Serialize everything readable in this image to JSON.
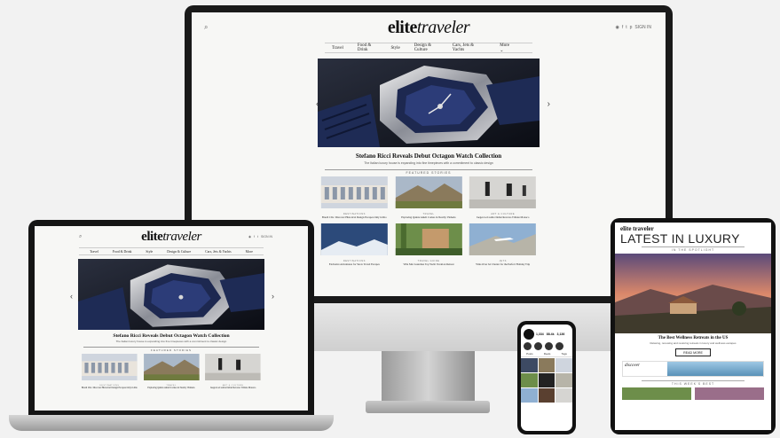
{
  "site": {
    "logo_a": "elite",
    "logo_b": "traveler",
    "signin": "SIGN IN",
    "nav": [
      "Travel",
      "Food & Drink",
      "Style",
      "Design & Culture",
      "Cars, Jets & Yachts",
      "More"
    ],
    "hero_title": "Stefano Ricci Reveals Debut Octagon Watch Collection",
    "hero_sub": "The Italian luxury house is expanding into fine timepieces with a commitment to classic design",
    "featured_label": "FEATURED STORIES",
    "cards": [
      {
        "cat": "DESTINATIONS",
        "title": "Brazil CIG: Discover Historical Design Escapes Only in Rio"
      },
      {
        "cat": "TRAVEL",
        "title": "Exploring Quinta Ameli Comes in Nearby Vinhedo"
      },
      {
        "cat": "ART & CULTURE",
        "title": "Jaeger-LeCoultre Debut Reverso Tribute Monaco"
      },
      {
        "cat": "DESTINATIONS",
        "title": "Exclusive Adventures for Snow Travel Escapes"
      },
      {
        "cat": "TRAVEL GUIDE",
        "title": "Villa Mar Launches Top Yacht Vacation Retreat"
      },
      {
        "cat": "JETS",
        "title": "Wins Over Jet Charter for the Perfect Holiday Trip"
      }
    ]
  },
  "tablet": {
    "logo": "elite traveler",
    "latest": "LATEST IN LUXURY",
    "spotlight": "IN THE SPOTLIGHT",
    "story_title": "The Best Wellness Retreats in the US",
    "story_sub": "Relaxing, renewing and restoring retreats in luxury and wellness escapes",
    "read_more": "READ MORE",
    "ad": "discover",
    "weeks_best": "THIS WEEK'S BEST"
  },
  "phone": {
    "stats": [
      "1,334",
      "88.4k",
      "3,136"
    ],
    "tabs": [
      "Posts",
      "Reels",
      "Tags"
    ]
  },
  "colors": {
    "bezel": "#151515",
    "page": "#f7f7f5",
    "accent": "#1f2a44"
  }
}
